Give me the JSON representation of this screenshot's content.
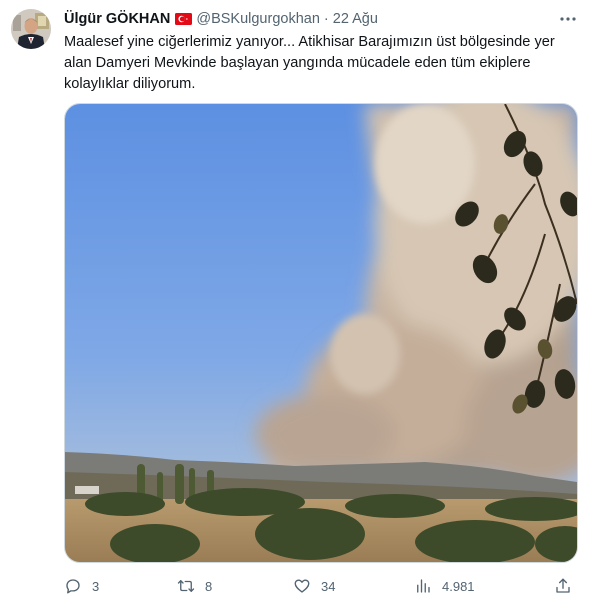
{
  "tweet": {
    "author_name": "Ülgür GÖKHAN",
    "flag_icon": "turkey-flag-icon",
    "handle": "@BSKulgurgokhan",
    "separator": "·",
    "timestamp": "22 Ağu",
    "text": "Maalesef yine ciğerlerimiz yanıyor... Atikhisar Barajımızın üst bölgesinde yer alan Damyeri Mevkinde başlayan yangında mücadele eden tüm ekiplere kolaylıklar diliyorum."
  },
  "actions": {
    "reply_count": "3",
    "retweet_count": "8",
    "like_count": "34",
    "views_count": "4.981"
  },
  "colors": {
    "text_primary": "#0f1419",
    "text_secondary": "#536471",
    "border": "#cfd9de",
    "flag_red": "#e30a17"
  }
}
